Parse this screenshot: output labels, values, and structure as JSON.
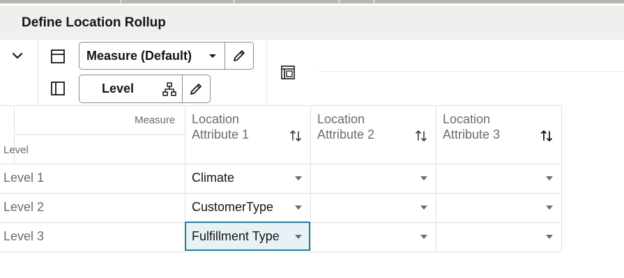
{
  "page": {
    "title": "Define Location Rollup"
  },
  "toolbar": {
    "measure_select_label": "Measure (Default)",
    "level_button_label": "Level",
    "icons": {
      "collapse": "chevron-down-icon",
      "measure_layout": "layout-rows-icon",
      "level_layout": "layout-columns-icon",
      "measure_dropdown": "caret-down-icon",
      "measure_edit": "pencil-icon",
      "level_hierarchy": "hierarchy-icon",
      "level_edit": "pencil-icon",
      "pivot": "pivot-layout-icon"
    }
  },
  "grid": {
    "corner_measure_label": "Measure",
    "corner_level_label": "Level",
    "columns": [
      {
        "line1": "Location",
        "line2": "Attribute 1"
      },
      {
        "line1": "Location",
        "line2": "Attribute 2"
      },
      {
        "line1": "Location",
        "line2": "Attribute 3"
      }
    ],
    "rows": [
      {
        "label": "Level 1",
        "values": [
          "Climate",
          "",
          ""
        ]
      },
      {
        "label": "Level 2",
        "values": [
          "CustomerType",
          "",
          ""
        ]
      },
      {
        "label": "Level 3",
        "values": [
          "Fulfillment Type",
          "",
          ""
        ]
      }
    ],
    "selected_cell": {
      "row": 3,
      "column": 1
    }
  },
  "colors": {
    "header_bg": "#f1efed",
    "selected_border": "#227e9e",
    "selected_bg": "#e7f2f6"
  }
}
